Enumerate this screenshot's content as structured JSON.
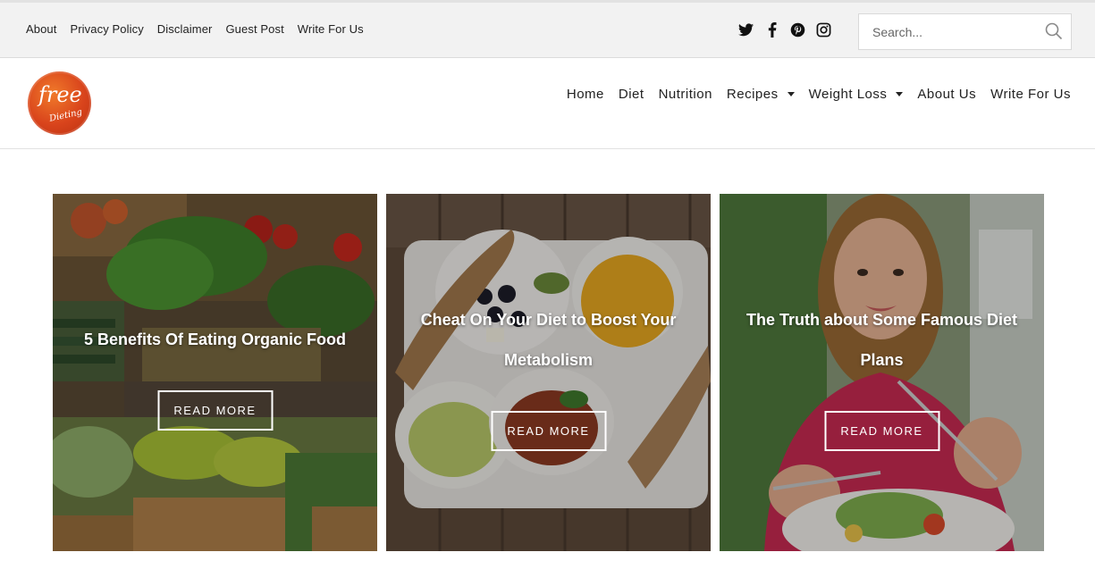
{
  "topbar": {
    "links": [
      "About",
      "Privacy Policy",
      "Disclaimer",
      "Guest Post",
      "Write For Us"
    ],
    "social": [
      "twitter-icon",
      "facebook-icon",
      "pinterest-icon",
      "instagram-icon"
    ],
    "search_placeholder": "Search..."
  },
  "header": {
    "logo_line1": "free",
    "logo_line2": "Dieting",
    "nav": [
      {
        "label": "Home"
      },
      {
        "label": "Diet"
      },
      {
        "label": "Nutrition"
      },
      {
        "label": "Recipes"
      },
      {
        "label": "Weight Loss"
      },
      {
        "label": "About Us"
      },
      {
        "label": "Write For Us"
      }
    ]
  },
  "cards": [
    {
      "title": "5 Benefits Of Eating Organic Food",
      "button": "READ MORE"
    },
    {
      "title": "Cheat On Your Diet to Boost Your Metabolism",
      "button": "READ MORE"
    },
    {
      "title": "The Truth about Some Famous Diet Plans",
      "button": "READ MORE"
    }
  ],
  "colors": {
    "logo": "#d9441c",
    "topbar_bg": "#f2f2f2",
    "text": "#222222"
  }
}
